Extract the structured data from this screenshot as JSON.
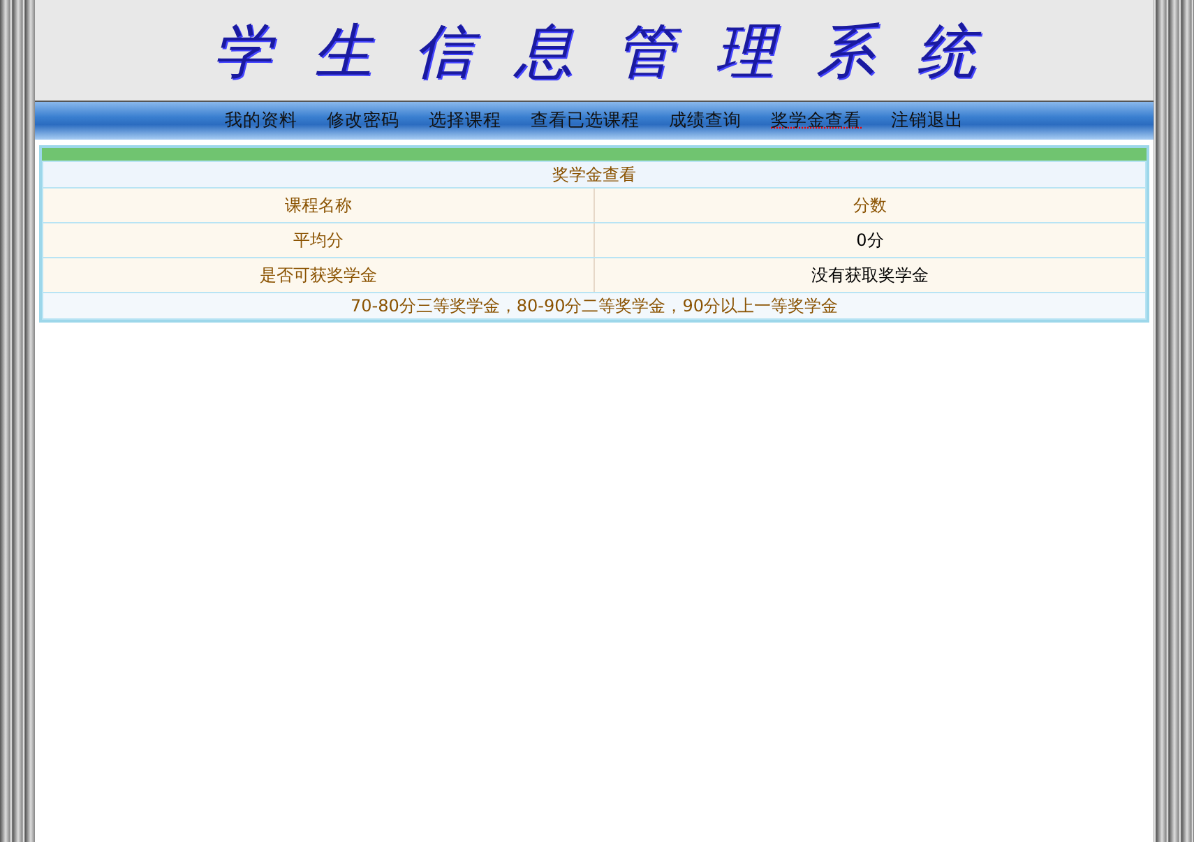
{
  "header": {
    "title": "学生信息管理系统"
  },
  "nav": [
    {
      "label": "我的资料",
      "selected": false
    },
    {
      "label": "修改密码",
      "selected": false
    },
    {
      "label": "选择课程",
      "selected": false
    },
    {
      "label": "查看已选课程",
      "selected": false
    },
    {
      "label": "成绩查询",
      "selected": false
    },
    {
      "label": "奖学金查看",
      "selected": true
    },
    {
      "label": "注销退出",
      "selected": false
    }
  ],
  "panel": {
    "title": "奖学金查看",
    "rows": [
      {
        "kind": "heading",
        "label": "课程名称",
        "value": "分数"
      },
      {
        "kind": "data",
        "label": "平均分",
        "value": "0分"
      },
      {
        "kind": "data",
        "label": "是否可获奖学金",
        "value": "没有获取奖学金"
      }
    ],
    "note": "70-80分三等奖学金，80-90分二等奖学金，90分以上一等奖学金"
  }
}
